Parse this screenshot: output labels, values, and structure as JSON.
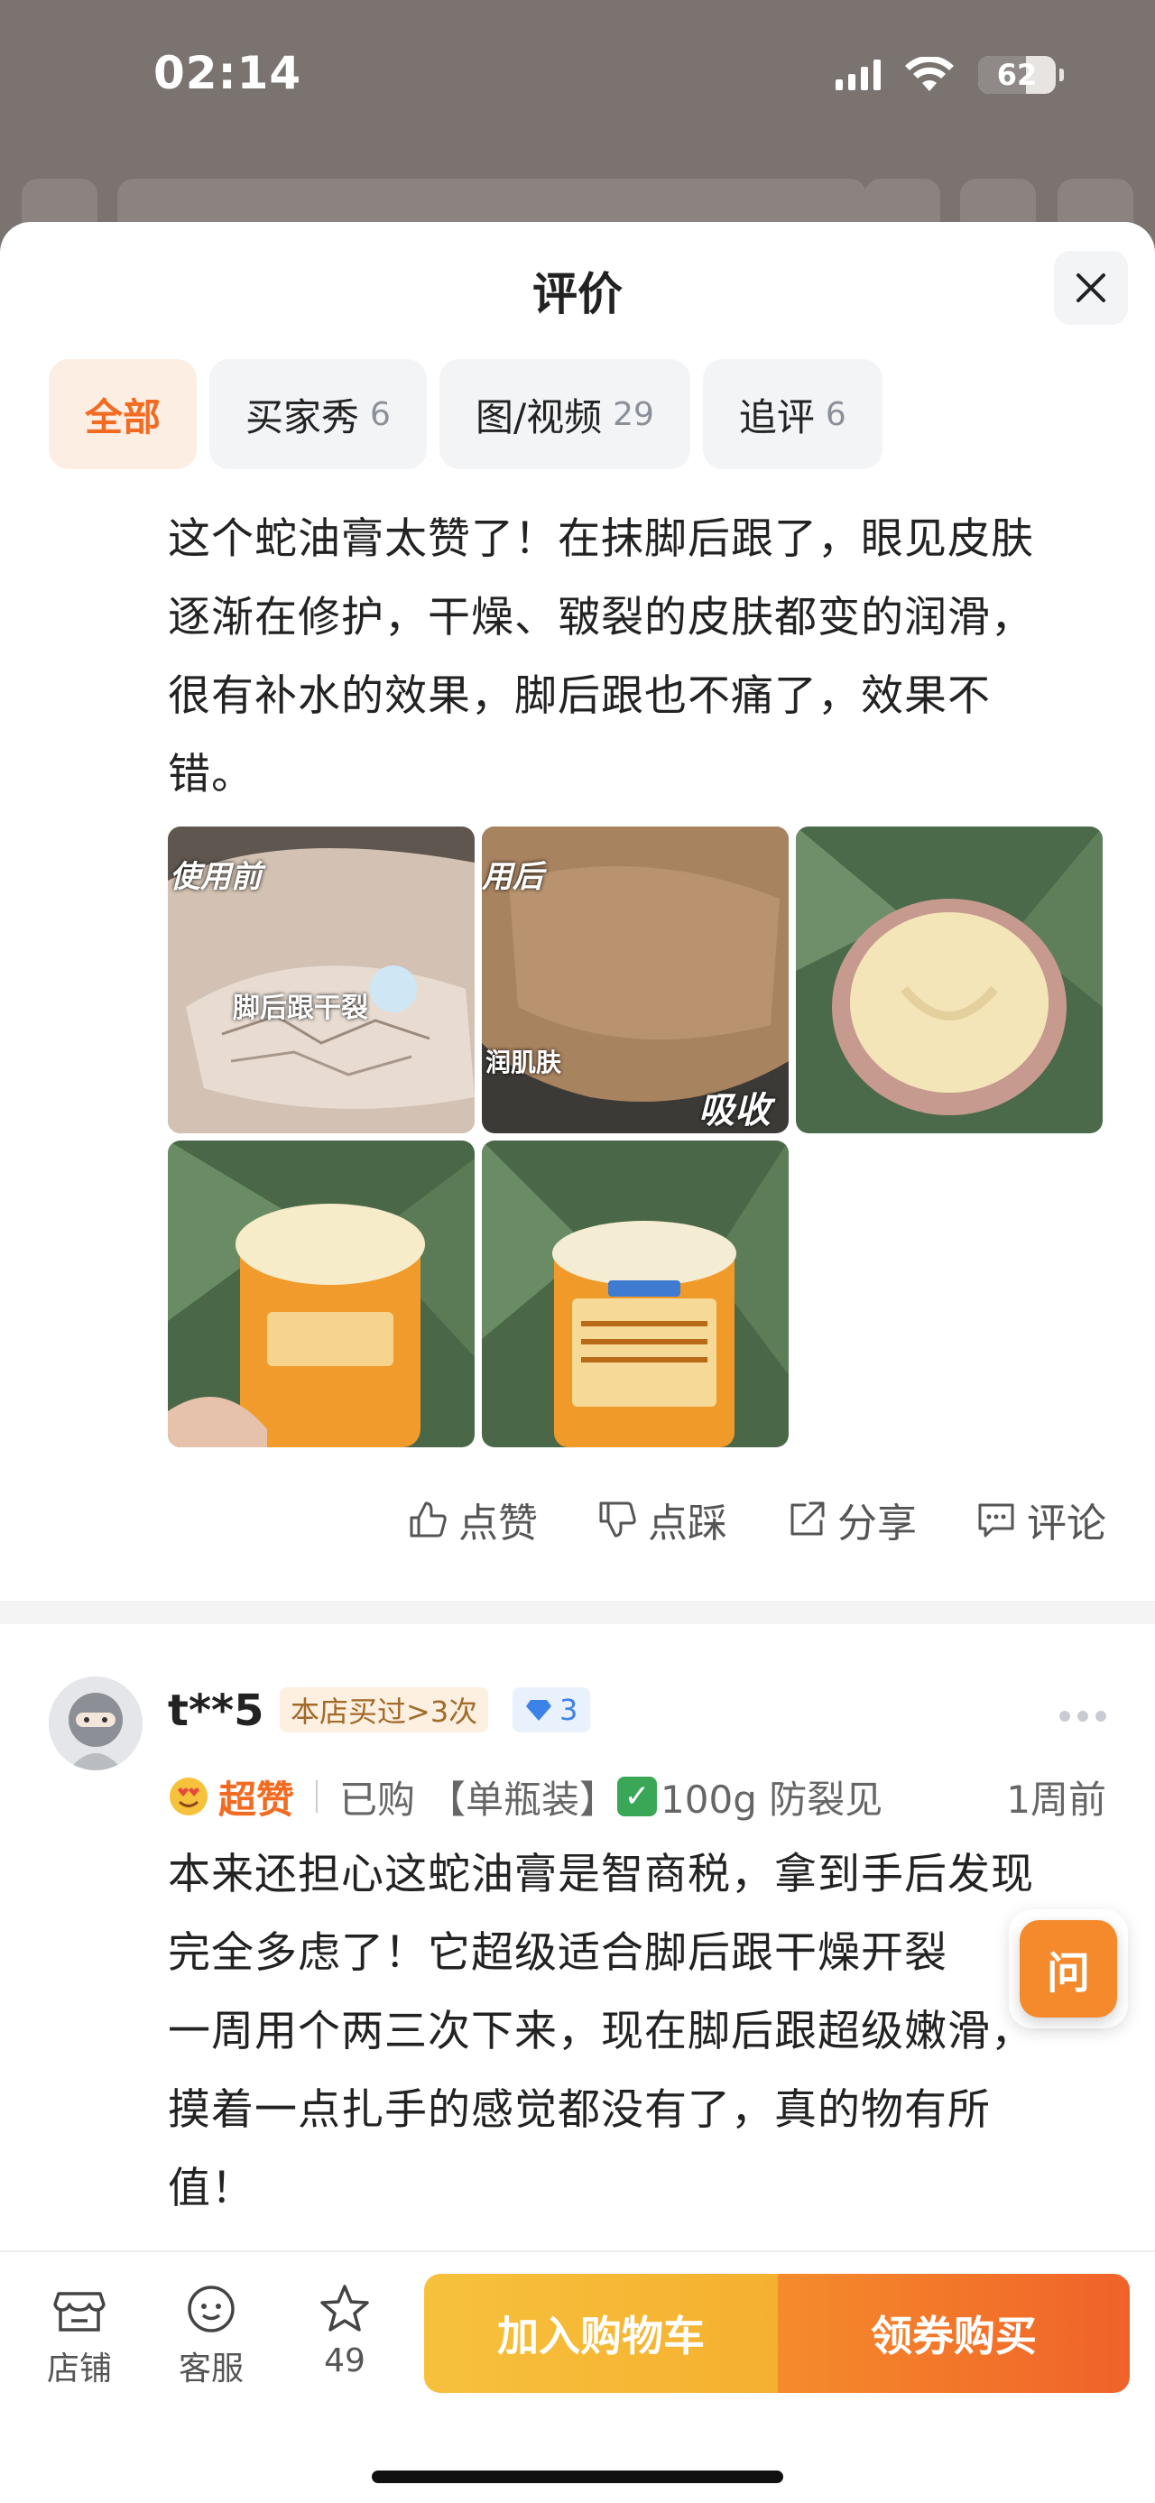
{
  "status_bar": {
    "time": "02:14",
    "battery": "62",
    "battery_level": 0.62
  },
  "sheet": {
    "title": "评价",
    "tabs": [
      {
        "label": "全部",
        "count": "",
        "active": true
      },
      {
        "label": "买家秀",
        "count": "6"
      },
      {
        "label": "图/视频",
        "count": "29"
      },
      {
        "label": "追评",
        "count": "6"
      }
    ]
  },
  "review1": {
    "text_lines": [
      "这个蛇油膏太赞了！在抹脚后跟了，眼见皮肤",
      "逐渐在修护，干燥、皲裂的皮肤都变的润滑，",
      "很有补水的效果，脚后跟也不痛了，效果不",
      "错。"
    ],
    "photos": [
      {
        "label": "使用前",
        "caption": "脚后跟干裂"
      },
      {
        "label": "用后",
        "caption": "润肌肤",
        "caption2": "吸收快"
      },
      {
        "label": ""
      },
      {
        "label": ""
      },
      {
        "label": ""
      }
    ],
    "actions": {
      "like": "点赞",
      "dislike": "点踩",
      "share": "分享",
      "comment": "评论"
    }
  },
  "review2": {
    "username": "t**5",
    "buy_badge": "本店买过>3次",
    "level": "3",
    "rating": "超赞",
    "purchase": "已购",
    "sku": "【单瓶装】",
    "spec": "100g 防裂见",
    "time_ago": "1周前",
    "text_lines": [
      "本来还担心这蛇油膏是智商税，拿到手后发现",
      "完全多虑了！它超级适合脚后跟干燥开裂",
      "一周用个两三次下来，现在脚后跟超级嫩滑，",
      "摸着一点扎手的感觉都没有了，真的物有所",
      "值！"
    ]
  },
  "ask_button": "问",
  "bottom_bar": {
    "shop": "店铺",
    "service": "客服",
    "favorites": "49",
    "add_to_cart": "加入购物车",
    "buy": "领券购买"
  },
  "colors": {
    "accent": "#f26b22",
    "cart": "#f7c13c",
    "buy": "#f0622a"
  }
}
